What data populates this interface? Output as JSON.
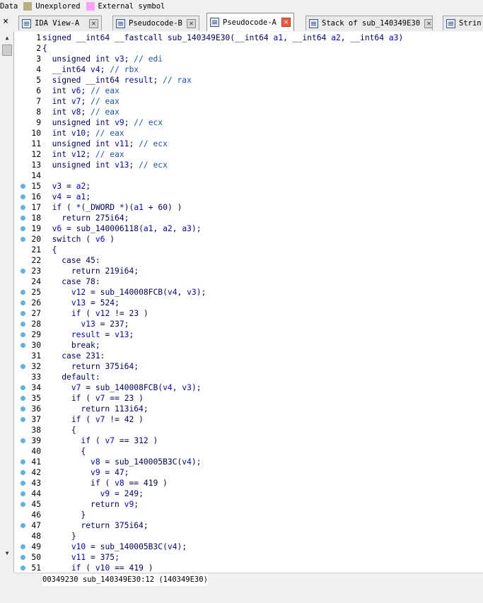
{
  "legend": [
    {
      "label": "Data",
      "color": "#f0f0f0"
    },
    {
      "label": "Unexplored",
      "color": "#b5b07a"
    },
    {
      "label": "External symbol",
      "color": "#ffa0ff"
    }
  ],
  "tabs": [
    {
      "label": "IDA View-A",
      "active": false
    },
    {
      "label": "Pseudocode-B",
      "active": false
    },
    {
      "label": "Pseudocode-A",
      "active": true
    },
    {
      "label": "Stack of sub_140349E30",
      "active": false
    },
    {
      "label": "Strin",
      "active": false
    }
  ],
  "left_close": "×",
  "code_lines": [
    {
      "n": "1",
      "bp": false,
      "t": "signed __int64 __fastcall sub_140349E30(__int64 a1, __int64 a2, __int64 a3)"
    },
    {
      "n": "2",
      "bp": false,
      "t": "{"
    },
    {
      "n": "3",
      "bp": false,
      "t": "  unsigned int v3; // edi"
    },
    {
      "n": "4",
      "bp": false,
      "t": "  __int64 v4; // rbx"
    },
    {
      "n": "5",
      "bp": false,
      "t": "  signed __int64 result; // rax"
    },
    {
      "n": "6",
      "bp": false,
      "t": "  int v6; // eax"
    },
    {
      "n": "7",
      "bp": false,
      "t": "  int v7; // eax"
    },
    {
      "n": "8",
      "bp": false,
      "t": "  int v8; // eax"
    },
    {
      "n": "9",
      "bp": false,
      "t": "  unsigned int v9; // ecx"
    },
    {
      "n": "10",
      "bp": false,
      "t": "  int v10; // eax"
    },
    {
      "n": "11",
      "bp": false,
      "t": "  unsigned int v11; // ecx"
    },
    {
      "n": "12",
      "bp": false,
      "t": "  int v12; // eax"
    },
    {
      "n": "13",
      "bp": false,
      "t": "  unsigned int v13; // ecx"
    },
    {
      "n": "14",
      "bp": false,
      "t": ""
    },
    {
      "n": "15",
      "bp": true,
      "t": "  v3 = a2;"
    },
    {
      "n": "16",
      "bp": true,
      "t": "  v4 = a1;"
    },
    {
      "n": "17",
      "bp": true,
      "t": "  if ( *(_DWORD *)(a1 + 60) )"
    },
    {
      "n": "18",
      "bp": true,
      "t": "    return 275i64;"
    },
    {
      "n": "19",
      "bp": true,
      "t": "  v6 = sub_140006118(a1, a2, a3);"
    },
    {
      "n": "20",
      "bp": true,
      "t": "  switch ( v6 )"
    },
    {
      "n": "21",
      "bp": false,
      "t": "  {"
    },
    {
      "n": "22",
      "bp": false,
      "t": "    case 45:"
    },
    {
      "n": "23",
      "bp": true,
      "t": "      return 219i64;"
    },
    {
      "n": "24",
      "bp": false,
      "t": "    case 78:"
    },
    {
      "n": "25",
      "bp": true,
      "t": "      v12 = sub_140008FCB(v4, v3);"
    },
    {
      "n": "26",
      "bp": true,
      "t": "      v13 = 524;"
    },
    {
      "n": "27",
      "bp": true,
      "t": "      if ( v12 != 23 )"
    },
    {
      "n": "28",
      "bp": true,
      "t": "        v13 = 237;"
    },
    {
      "n": "29",
      "bp": true,
      "t": "      result = v13;"
    },
    {
      "n": "30",
      "bp": true,
      "t": "      break;"
    },
    {
      "n": "31",
      "bp": false,
      "t": "    case 231:"
    },
    {
      "n": "32",
      "bp": true,
      "t": "      return 375i64;"
    },
    {
      "n": "33",
      "bp": false,
      "t": "    default:"
    },
    {
      "n": "34",
      "bp": true,
      "t": "      v7 = sub_140008FCB(v4, v3);"
    },
    {
      "n": "35",
      "bp": true,
      "t": "      if ( v7 == 23 )"
    },
    {
      "n": "36",
      "bp": true,
      "t": "        return 113i64;"
    },
    {
      "n": "37",
      "bp": true,
      "t": "      if ( v7 != 42 )"
    },
    {
      "n": "38",
      "bp": false,
      "t": "      {"
    },
    {
      "n": "39",
      "bp": true,
      "t": "        if ( v7 == 312 )"
    },
    {
      "n": "40",
      "bp": false,
      "t": "        {"
    },
    {
      "n": "41",
      "bp": true,
      "t": "          v8 = sub_140005B3C(v4);"
    },
    {
      "n": "42",
      "bp": true,
      "t": "          v9 = 47;"
    },
    {
      "n": "43",
      "bp": true,
      "t": "          if ( v8 == 419 )"
    },
    {
      "n": "44",
      "bp": true,
      "t": "            v9 = 249;"
    },
    {
      "n": "45",
      "bp": true,
      "t": "          return v9;"
    },
    {
      "n": "46",
      "bp": false,
      "t": "        }"
    },
    {
      "n": "47",
      "bp": true,
      "t": "        return 375i64;"
    },
    {
      "n": "48",
      "bp": false,
      "t": "      }"
    },
    {
      "n": "49",
      "bp": true,
      "t": "      v10 = sub_140005B3C(v4);"
    },
    {
      "n": "50",
      "bp": true,
      "t": "      v11 = 375;"
    },
    {
      "n": "51",
      "bp": true,
      "t": "      if ( v10 == 419 )"
    }
  ],
  "status_text": "00349230 sub_140349E30:12 (140349E30)",
  "colors": {
    "breakpoint": "#5ab4ea",
    "keyword": "#000080",
    "variable": "#0000ff",
    "comment": "#1a53c9",
    "active_close": "#f25b3a"
  }
}
